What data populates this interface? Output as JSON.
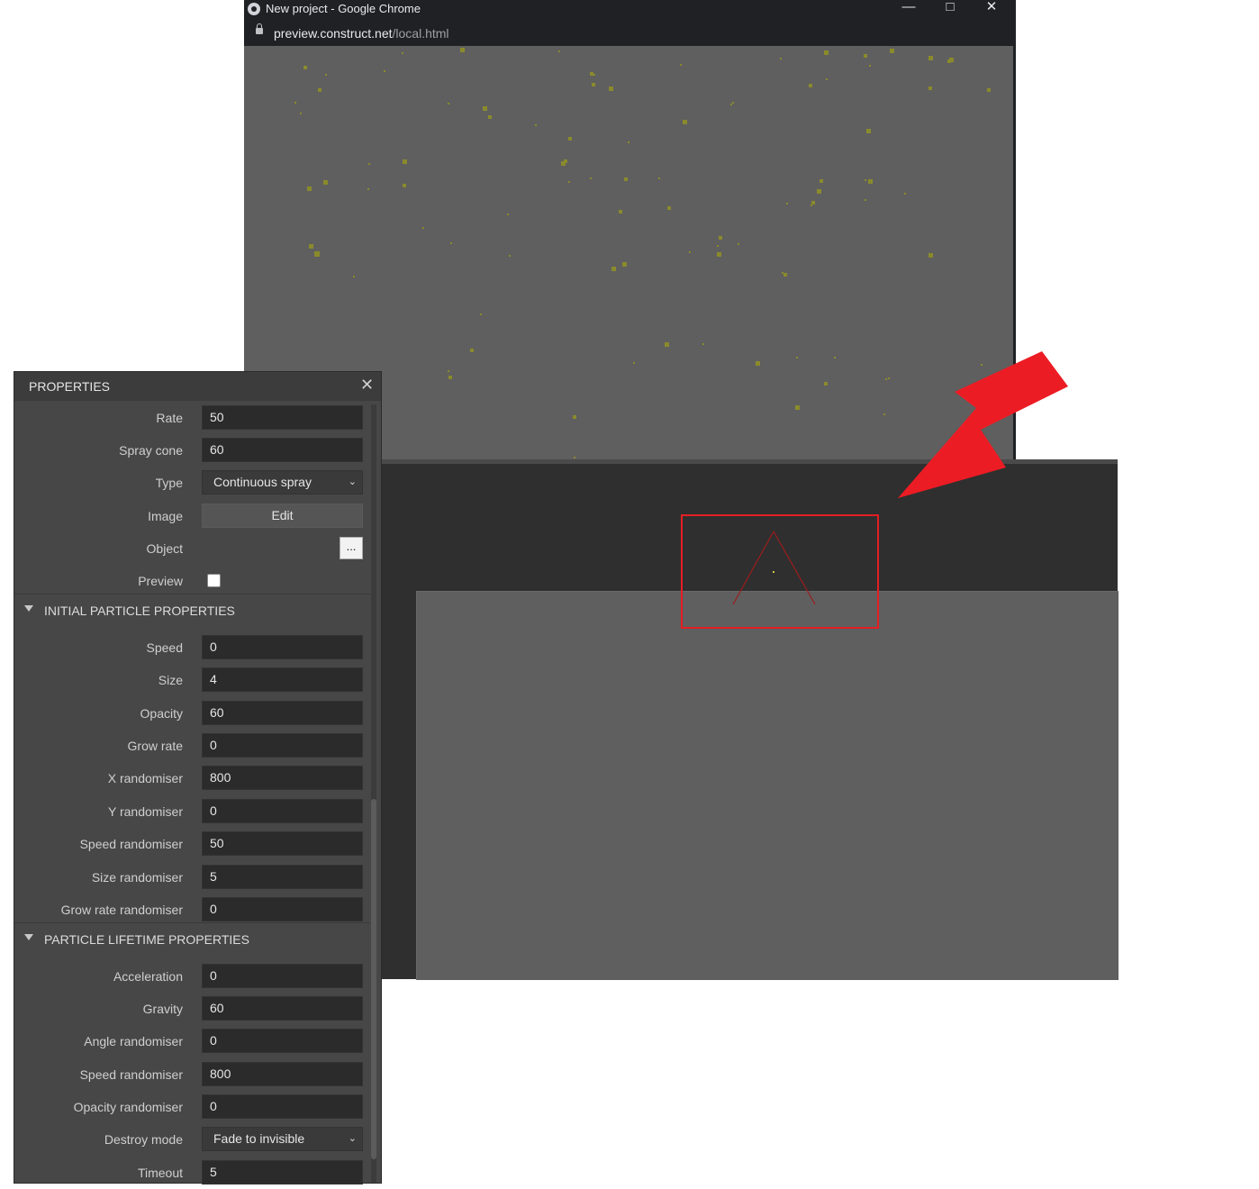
{
  "browser": {
    "title": "New project - Google Chrome",
    "url_host": "preview.construct.net",
    "url_path": "/local.html",
    "controls": [
      "minimize",
      "maximize",
      "close"
    ]
  },
  "properties_panel": {
    "title": "PROPERTIES",
    "general": [
      {
        "label": "Rate",
        "value": "50",
        "kind": "input"
      },
      {
        "label": "Spray cone",
        "value": "60",
        "kind": "input"
      },
      {
        "label": "Type",
        "value": "Continuous spray",
        "kind": "select"
      },
      {
        "label": "Image",
        "value": "Edit",
        "kind": "button"
      },
      {
        "label": "Object",
        "value": "...",
        "kind": "picker"
      },
      {
        "label": "Preview",
        "value": "",
        "kind": "checkbox",
        "checked": false
      }
    ],
    "initial_section": {
      "title": "INITIAL PARTICLE PROPERTIES",
      "rows": [
        {
          "label": "Speed",
          "value": "0"
        },
        {
          "label": "Size",
          "value": "4"
        },
        {
          "label": "Opacity",
          "value": "60"
        },
        {
          "label": "Grow rate",
          "value": "0"
        },
        {
          "label": "X randomiser",
          "value": "800"
        },
        {
          "label": "Y randomiser",
          "value": "0"
        },
        {
          "label": "Speed randomiser",
          "value": "50"
        },
        {
          "label": "Size randomiser",
          "value": "5"
        },
        {
          "label": "Grow rate randomiser",
          "value": "0"
        }
      ]
    },
    "lifetime_section": {
      "title": "PARTICLE LIFETIME PROPERTIES",
      "rows": [
        {
          "label": "Acceleration",
          "value": "0",
          "kind": "input"
        },
        {
          "label": "Gravity",
          "value": "60",
          "kind": "input"
        },
        {
          "label": "Angle randomiser",
          "value": "0",
          "kind": "input"
        },
        {
          "label": "Speed randomiser",
          "value": "800",
          "kind": "input"
        },
        {
          "label": "Opacity randomiser",
          "value": "0",
          "kind": "input"
        },
        {
          "label": "Destroy mode",
          "value": "Fade to invisible",
          "kind": "select"
        },
        {
          "label": "Timeout",
          "value": "5",
          "kind": "input"
        }
      ]
    }
  },
  "colors": {
    "particle": "#8a8a2c",
    "canvas": "#5f5f5f",
    "highlight": "#e31e24",
    "arrow": "#ec1c24",
    "spray_cone": "#9b1c1c"
  }
}
